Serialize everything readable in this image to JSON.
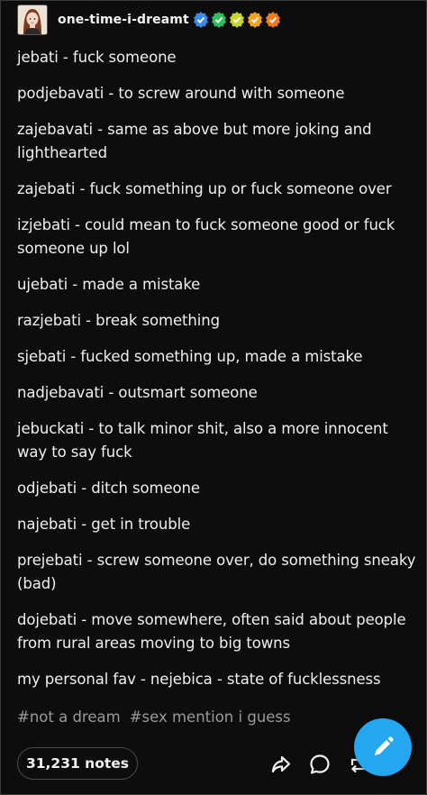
{
  "post": {
    "username": "one-time-i-dreamt",
    "badges": [
      {
        "icon": "verified-badge-icon",
        "color": "#3d8be8"
      },
      {
        "icon": "check-badge-icon",
        "color": "#2fbf5a"
      },
      {
        "icon": "check-badge-icon",
        "color": "#c8d62a"
      },
      {
        "icon": "check-badge-icon",
        "color": "#f2a21e"
      },
      {
        "icon": "check-badge-icon",
        "color": "#f07a1e"
      }
    ],
    "lines": [
      "jebati - fuck someone",
      "podjebavati - to screw around with someone",
      "zajebavati - same as above but more joking and lighthearted",
      "zajebati - fuck something up or fuck someone over",
      "izjebati - could mean to fuck someone good or fuck someone up lol",
      "ujebati - made a mistake",
      "razjebati - break something",
      "sjebati - fucked something up, made a mistake",
      "nadjebavati - outsmart someone",
      "jebuckati - to talk minor shit, also a more innocent way to say fuck",
      "odjebati - ditch someone",
      "najebati - get in trouble",
      "prejebati - screw someone over, do something sneaky (bad)",
      "dojebati - move somewhere, often said about people from rural areas moving to big towns",
      "my personal fav - nejebica - state of fucklessness"
    ],
    "tags": [
      "#not a dream",
      "#sex mention i guess"
    ],
    "notes_label": "31,231 notes"
  },
  "colors": {
    "background": "#0d0d0d",
    "text": "#efefef",
    "tag_text": "#9a9a9a",
    "fab": "#24a6f0"
  },
  "icons": {
    "share": "share-icon",
    "comment": "comment-icon",
    "reblog": "reblog-icon",
    "compose": "pencil-icon"
  }
}
